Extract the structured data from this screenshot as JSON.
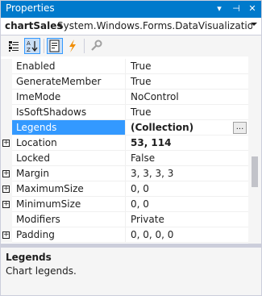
{
  "window": {
    "title": "Properties"
  },
  "titlebar_controls": {
    "dropdown": "▾",
    "pin": "⊣",
    "close": "✕"
  },
  "object_selector": {
    "name": "chartSales",
    "type": "System.Windows.Forms.DataVisualization.Chart"
  },
  "toolbar": {
    "buttons": [
      {
        "icon": "categorized-icon",
        "active": false
      },
      {
        "icon": "alphabetical-icon",
        "active": true
      },
      {
        "icon": "properties-icon",
        "active": true
      },
      {
        "icon": "events-icon",
        "active": false
      },
      {
        "icon": "property-pages-icon",
        "active": false
      }
    ]
  },
  "properties": [
    {
      "name": "Enabled",
      "value": "True",
      "expandable": false,
      "selected": false,
      "bold": false
    },
    {
      "name": "GenerateMember",
      "value": "True",
      "expandable": false,
      "selected": false,
      "bold": false
    },
    {
      "name": "ImeMode",
      "value": "NoControl",
      "expandable": false,
      "selected": false,
      "bold": false
    },
    {
      "name": "IsSoftShadows",
      "value": "True",
      "expandable": false,
      "selected": false,
      "bold": false
    },
    {
      "name": "Legends",
      "value": "(Collection)",
      "expandable": false,
      "selected": true,
      "bold": true,
      "ellipsis": "..."
    },
    {
      "name": "Location",
      "value": "53, 114",
      "expandable": true,
      "selected": false,
      "bold": true
    },
    {
      "name": "Locked",
      "value": "False",
      "expandable": false,
      "selected": false,
      "bold": false
    },
    {
      "name": "Margin",
      "value": "3, 3, 3, 3",
      "expandable": true,
      "selected": false,
      "bold": false
    },
    {
      "name": "MaximumSize",
      "value": "0, 0",
      "expandable": true,
      "selected": false,
      "bold": false
    },
    {
      "name": "MinimumSize",
      "value": "0, 0",
      "expandable": true,
      "selected": false,
      "bold": false
    },
    {
      "name": "Modifiers",
      "value": "Private",
      "expandable": false,
      "selected": false,
      "bold": false
    },
    {
      "name": "Padding",
      "value": "0, 0, 0, 0",
      "expandable": true,
      "selected": false,
      "bold": false
    }
  ],
  "description": {
    "title": "Legends",
    "text": "Chart legends."
  },
  "colors": {
    "accent": "#007acc",
    "selection": "#3399ff"
  }
}
